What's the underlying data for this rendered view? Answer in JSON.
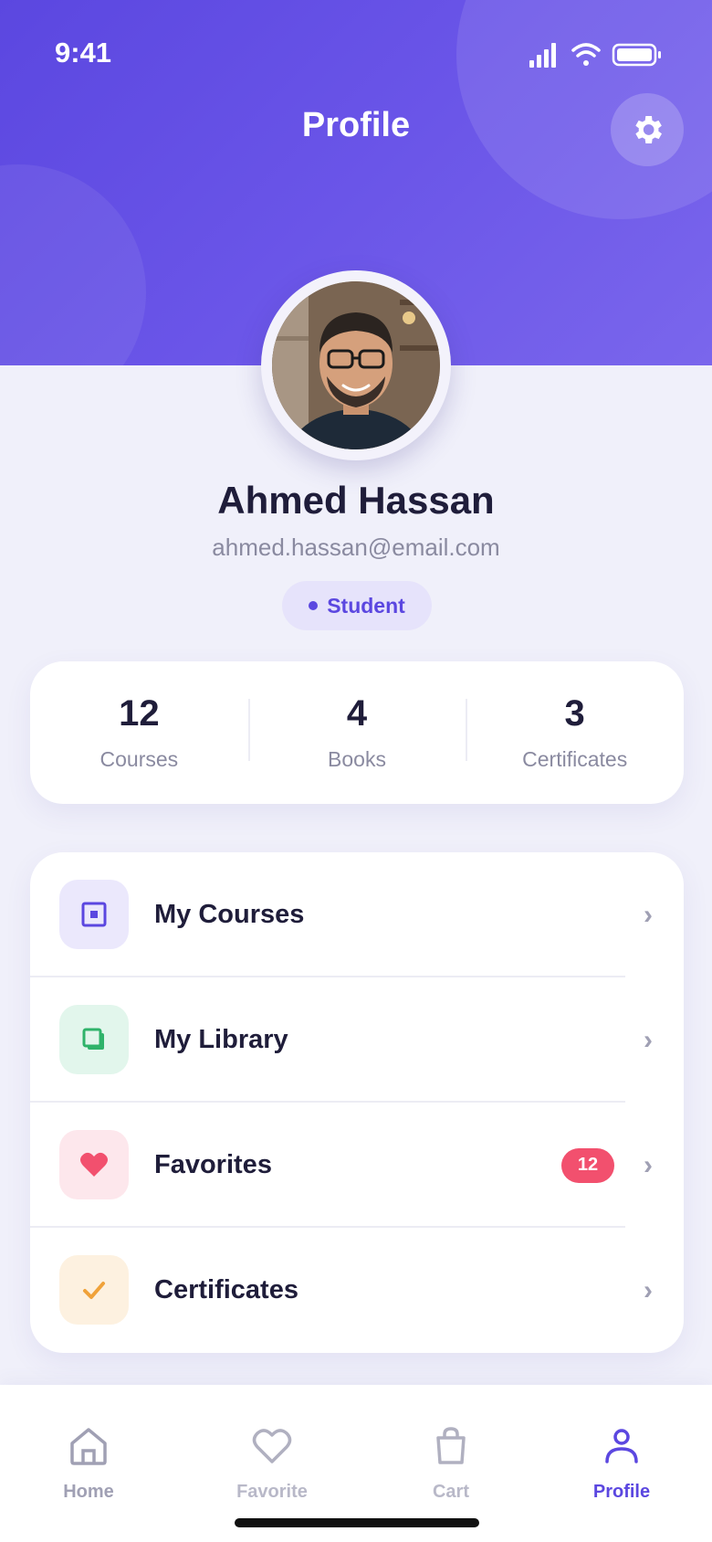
{
  "status_bar": {
    "time": "9:41"
  },
  "header": {
    "title": "Profile"
  },
  "profile": {
    "name": "Ahmed Hassan",
    "email": "ahmed.hassan@email.com",
    "role": "Student"
  },
  "stats": [
    {
      "value": "12",
      "label": "Courses"
    },
    {
      "value": "4",
      "label": "Books"
    },
    {
      "value": "3",
      "label": "Certificates"
    }
  ],
  "menu": [
    {
      "label": "My Courses",
      "icon": "course-icon",
      "icon_bg": "#ebe8fc",
      "icon_color": "#5b47e0"
    },
    {
      "label": "My Library",
      "icon": "book-icon",
      "icon_bg": "#e2f6ec",
      "icon_color": "#2fb36a"
    },
    {
      "label": "Favorites",
      "icon": "heart-icon",
      "icon_bg": "#fde7ec",
      "icon_color": "#f2506e",
      "badge": "12"
    },
    {
      "label": "Certificates",
      "icon": "check-icon",
      "icon_bg": "#fdf1e0",
      "icon_color": "#f0a23a"
    }
  ],
  "tabs": [
    {
      "label": "Home",
      "active": false
    },
    {
      "label": "Favorite",
      "active": false
    },
    {
      "label": "Cart",
      "active": false
    },
    {
      "label": "Profile",
      "active": true
    }
  ],
  "colors": {
    "accent": "#5b47e0",
    "inactive_tab": "#a0a0b4",
    "inactive_tab_light": "#b8b8c8"
  }
}
